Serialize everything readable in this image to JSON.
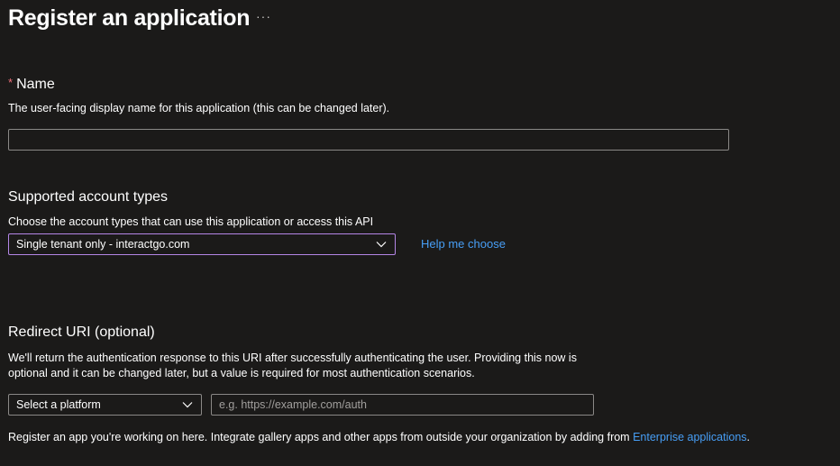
{
  "header": {
    "title": "Register an application",
    "more_glyph": "···"
  },
  "name_section": {
    "required_marker": "*",
    "label": "Name",
    "description": "The user-facing display name for this application (this can be changed later).",
    "input_value": "",
    "input_placeholder": ""
  },
  "account_types_section": {
    "label": "Supported account types",
    "description": "Choose the account types that can use this application or access this API",
    "selected": "Single tenant only - interactgo.com",
    "help_link": "Help me choose"
  },
  "redirect_section": {
    "label": "Redirect URI (optional)",
    "description_line1": "We'll return the authentication response to this URI after successfully authenticating the user. Providing this now is",
    "description_line2": "optional and it can be changed later, but a value is required for most authentication scenarios.",
    "platform_selected": "Select a platform",
    "uri_value": "",
    "uri_placeholder": "e.g. https://example.com/auth"
  },
  "footer": {
    "text": "Register an app you're working on here. Integrate gallery apps and other apps from outside your organization by adding from ",
    "link": "Enterprise applications",
    "suffix": "."
  },
  "icons": {
    "more": "more-horizontal-icon",
    "chevron": "chevron-down-icon"
  },
  "colors": {
    "background": "#1b1a19",
    "link": "#479ef5",
    "required": "#f1707b",
    "focus_border": "#b486e6"
  }
}
